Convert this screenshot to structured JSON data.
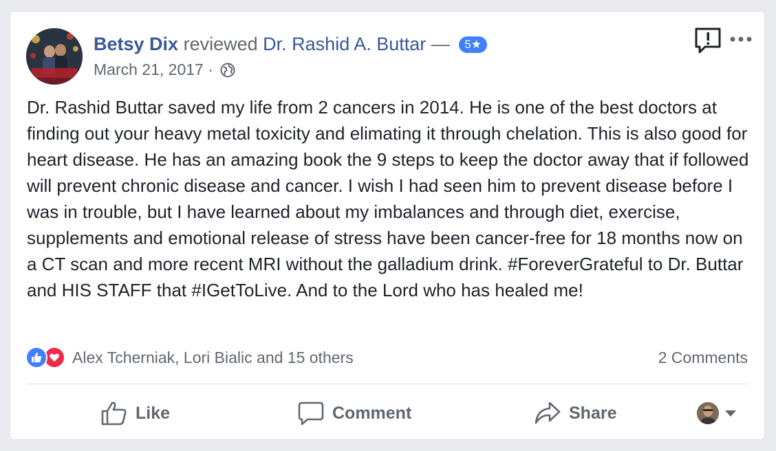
{
  "post": {
    "author": "Betsy Dix",
    "action_text": "reviewed",
    "page_name": "Dr. Rashid A. Buttar",
    "dash": "—",
    "rating": "5★",
    "date": "March 21, 2017",
    "separator": "·",
    "privacy_icon": "globe-icon",
    "text": "Dr. Rashid Buttar saved my life from 2 cancers in 2014. He is one of the best doctors at finding out your heavy metal toxicity and elimating it through chelation. This is also good for heart disease. He has an amazing book the 9 steps to keep the doctor away that if followed will prevent chronic disease and cancer. I wish I had seen him to prevent disease before I was in trouble, but I have learned about my imbalances and through diet, exercise, supplements and emotional release of stress have been cancer-free for 18 months now on a CT scan and more recent MRI without the galladium drink. #ForeverGrateful to Dr. Buttar and HIS STAFF that #IGetToLive. And to the Lord who has healed me!"
  },
  "icons": {
    "report": "report-exclamation-icon",
    "more": "more-options-icon"
  },
  "reactions": {
    "icons": [
      "like-reaction-icon",
      "love-reaction-icon"
    ],
    "summary": "Alex Tcherniak, Lori Bialic and 15 others",
    "comments": "2 Comments"
  },
  "actions": {
    "like": "Like",
    "comment": "Comment",
    "share": "Share"
  },
  "colors": {
    "link": "#385898",
    "badge": "#4080ff",
    "like": "#4080ff",
    "love": "#f0284a",
    "muted": "#616770",
    "text": "#1d2129"
  }
}
